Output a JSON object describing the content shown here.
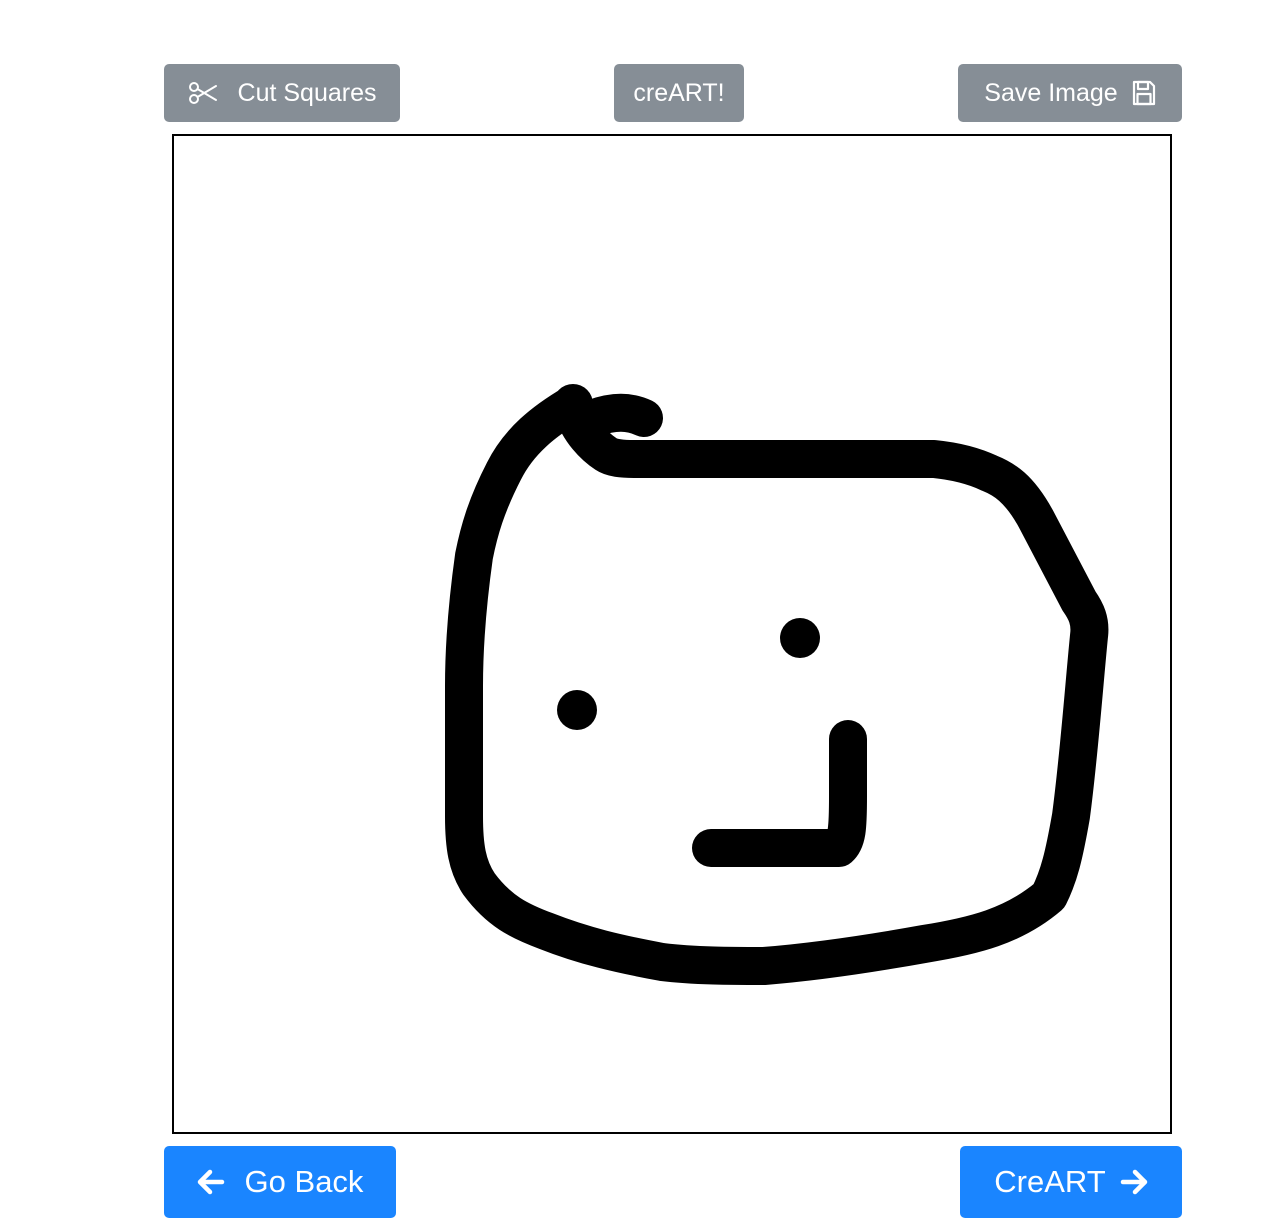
{
  "toolbar": {
    "cut_label": "Cut Squares",
    "cut_icon": "scissors-icon",
    "creart_label": "creART!",
    "save_label": "Save Image",
    "save_icon": "floppy-disk-icon"
  },
  "footer": {
    "back_label": "Go Back",
    "back_icon": "arrow-left-icon",
    "creart_label": "CreART",
    "creart_icon": "arrow-right-icon"
  },
  "colors": {
    "secondary_button": "#868e96",
    "primary_button": "#1a85ff",
    "stroke": "#000000"
  }
}
